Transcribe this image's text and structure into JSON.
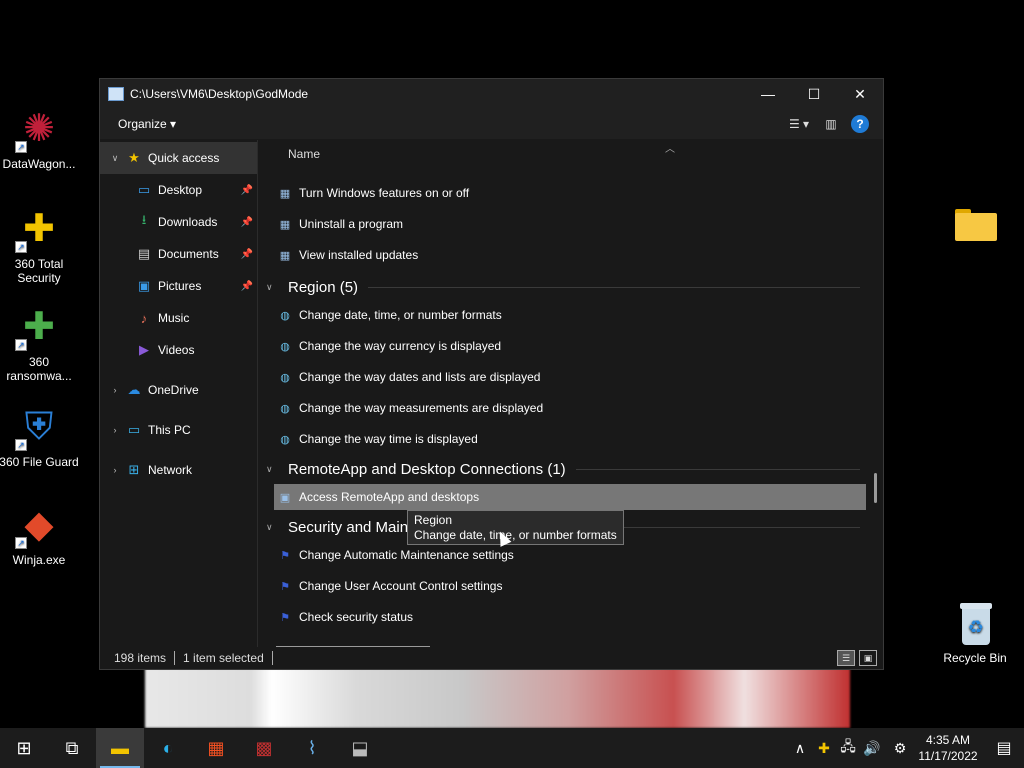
{
  "desktop_icons": [
    {
      "name": "datawagon-icon",
      "label": "DataWagon...",
      "symbol": "✺",
      "color": "#c0203a"
    },
    {
      "name": "360-total-security-icon",
      "label": "360 Total Security",
      "symbol": "✚",
      "color": "#f2c400"
    },
    {
      "name": "360-ransomware-icon",
      "label": "360 ransomwa...",
      "symbol": "✚",
      "color": "#4cae4c"
    },
    {
      "name": "360-file-guard-icon",
      "label": "360 File Guard",
      "symbol": "⛨",
      "color": "#2a7fd6"
    },
    {
      "name": "winja-icon",
      "label": "Winja.exe",
      "symbol": "◆",
      "color": "#e24a2a"
    }
  ],
  "folder_icon": {
    "label": "",
    "color": "#f7c843"
  },
  "recycle_bin": {
    "label": "Recycle Bin"
  },
  "window": {
    "title": "C:\\Users\\VM6\\Desktop\\GodMode",
    "controls": {
      "minimize": "—",
      "maximize": "☐",
      "close": "✕"
    },
    "toolbar": {
      "organize": "Organize ▾",
      "help": "?"
    },
    "column_header": "Name"
  },
  "nav": [
    {
      "label": "Quick access",
      "icon": "★",
      "icon_color": "#f2c400",
      "chevron": "∨",
      "selected": true,
      "indent": 0,
      "pinned": false
    },
    {
      "label": "Desktop",
      "icon": "▭",
      "icon_color": "#3a9be8",
      "chevron": "",
      "selected": false,
      "indent": 1,
      "pinned": true
    },
    {
      "label": "Downloads",
      "icon": "⭳",
      "icon_color": "#35b06a",
      "chevron": "",
      "selected": false,
      "indent": 1,
      "pinned": true
    },
    {
      "label": "Documents",
      "icon": "▤",
      "icon_color": "#cccccc",
      "chevron": "",
      "selected": false,
      "indent": 1,
      "pinned": true
    },
    {
      "label": "Pictures",
      "icon": "▣",
      "icon_color": "#3a9be8",
      "chevron": "",
      "selected": false,
      "indent": 1,
      "pinned": true
    },
    {
      "label": "Music",
      "icon": "♪",
      "icon_color": "#e8715a",
      "chevron": "",
      "selected": false,
      "indent": 1,
      "pinned": false
    },
    {
      "label": "Videos",
      "icon": "▶",
      "icon_color": "#8a5ad8",
      "chevron": "",
      "selected": false,
      "indent": 1,
      "pinned": false
    },
    {
      "label": "OneDrive",
      "icon": "☁",
      "icon_color": "#2a8ae0",
      "chevron": "›",
      "selected": false,
      "indent": 0,
      "pinned": false
    },
    {
      "label": "This PC",
      "icon": "▭",
      "icon_color": "#3ab0e8",
      "chevron": "›",
      "selected": false,
      "indent": 0,
      "pinned": false
    },
    {
      "label": "Network",
      "icon": "⊞",
      "icon_color": "#3ab0e8",
      "chevron": "›",
      "selected": false,
      "indent": 0,
      "pinned": false
    }
  ],
  "content": {
    "partial_top": "Turn Windows features on or off",
    "items_top": [
      {
        "label": "Turn Windows features on or off",
        "icon": "▦"
      },
      {
        "label": "Uninstall a program",
        "icon": "▦"
      },
      {
        "label": "View installed updates",
        "icon": "▦"
      }
    ],
    "groups": [
      {
        "title": "Region (5)",
        "items": [
          {
            "label": "Change date, time, or number formats",
            "icon": "◍"
          },
          {
            "label": "Change the way currency is displayed",
            "icon": "◍"
          },
          {
            "label": "Change the way dates and lists are displayed",
            "icon": "◍"
          },
          {
            "label": "Change the way measurements are displayed",
            "icon": "◍"
          },
          {
            "label": "Change the way time is displayed",
            "icon": "◍"
          }
        ]
      },
      {
        "title": "RemoteApp and Desktop Connections (1)",
        "items": [
          {
            "label": "Access RemoteApp and desktops",
            "icon": "▣",
            "selected": true
          }
        ]
      },
      {
        "title": "Security and Mainte",
        "items": [
          {
            "label": "Change Automatic Maintenance settings",
            "icon": "⚑"
          },
          {
            "label": "Change User Account Control settings",
            "icon": "⚑"
          },
          {
            "label": "Check security status",
            "icon": "⚑"
          }
        ]
      }
    ]
  },
  "tooltip": {
    "title": "Region",
    "text": "Change date, time, or number formats"
  },
  "status": {
    "count": "198 items",
    "selected": "1 item selected"
  },
  "taskbar": {
    "apps": [
      {
        "name": "start-button",
        "symbol": "⊞",
        "color": "#ffffff"
      },
      {
        "name": "task-view-button",
        "symbol": "⧉",
        "color": "#ffffff"
      },
      {
        "name": "file-explorer-button",
        "symbol": "▬",
        "color": "#f2c400",
        "active": true
      },
      {
        "name": "edge-button",
        "symbol": "◐",
        "color": "#2bb0e8"
      },
      {
        "name": "store-button",
        "symbol": "▦",
        "color": "#f25022"
      },
      {
        "name": "app-red-button",
        "symbol": "▩",
        "color": "#c03030"
      },
      {
        "name": "app-monitor-button",
        "symbol": "⌇",
        "color": "#6ab0e8"
      },
      {
        "name": "app-drive-button",
        "symbol": "⬓",
        "color": "#bbbbbb"
      }
    ],
    "tray": {
      "chevron": "∧",
      "time": "4:35 AM",
      "date": "11/17/2022"
    }
  }
}
